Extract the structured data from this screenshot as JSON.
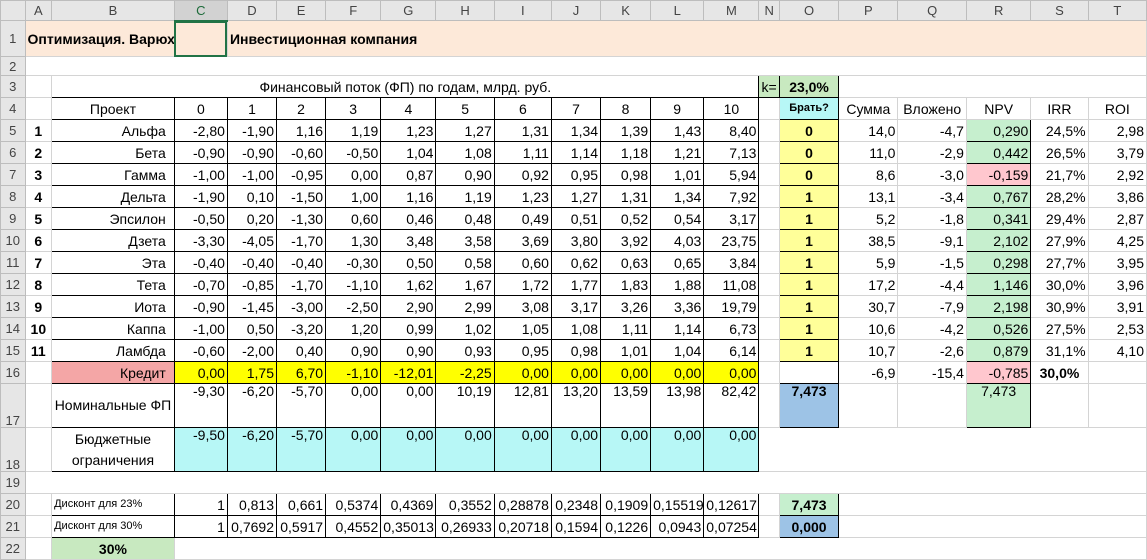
{
  "columns": [
    "A",
    "B",
    "C",
    "D",
    "E",
    "F",
    "G",
    "H",
    "I",
    "J",
    "K",
    "L",
    "M",
    "N",
    "O",
    "P",
    "Q",
    "R",
    "S",
    "T"
  ],
  "title_box": "Оптимизация. Варюхин С.Е. 2021 гг",
  "title": "Инвестиционная компания",
  "row3": {
    "label": "Финансовый поток (ФП) по годам, млрд. руб.",
    "k_label": "k=",
    "k_value": "23,0%"
  },
  "row4": {
    "project": "Проект",
    "years": [
      "0",
      "1",
      "2",
      "3",
      "4",
      "5",
      "6",
      "7",
      "8",
      "9",
      "10"
    ],
    "take": "Брать?",
    "sum": "Сумма",
    "invested": "Вложено",
    "npv": "NPV",
    "irr": "IRR",
    "roi": "ROI"
  },
  "projects": [
    {
      "idx": "1",
      "name": "Альфа",
      "flows": [
        "-2,80",
        "-1,90",
        "1,16",
        "1,19",
        "1,23",
        "1,27",
        "1,31",
        "1,34",
        "1,39",
        "1,43",
        "8,40"
      ],
      "take": "0",
      "sum": "14,0",
      "inv": "-4,7",
      "npv": "0,290",
      "irr": "24,5%",
      "roi": "2,98",
      "neg": false
    },
    {
      "idx": "2",
      "name": "Бета",
      "flows": [
        "-0,90",
        "-0,90",
        "-0,60",
        "-0,50",
        "1,04",
        "1,08",
        "1,11",
        "1,14",
        "1,18",
        "1,21",
        "7,13"
      ],
      "take": "0",
      "sum": "11,0",
      "inv": "-2,9",
      "npv": "0,442",
      "irr": "26,5%",
      "roi": "3,79",
      "neg": false
    },
    {
      "idx": "3",
      "name": "Гамма",
      "flows": [
        "-1,00",
        "-1,00",
        "-0,95",
        "0,00",
        "0,87",
        "0,90",
        "0,92",
        "0,95",
        "0,98",
        "1,01",
        "5,94"
      ],
      "take": "0",
      "sum": "8,6",
      "inv": "-3,0",
      "npv": "-0,159",
      "irr": "21,7%",
      "roi": "2,92",
      "neg": true
    },
    {
      "idx": "4",
      "name": "Дельта",
      "flows": [
        "-1,90",
        "0,10",
        "-1,50",
        "1,00",
        "1,16",
        "1,19",
        "1,23",
        "1,27",
        "1,31",
        "1,34",
        "7,92"
      ],
      "take": "1",
      "sum": "13,1",
      "inv": "-3,4",
      "npv": "0,767",
      "irr": "28,2%",
      "roi": "3,86",
      "neg": false
    },
    {
      "idx": "5",
      "name": "Эпсилон",
      "flows": [
        "-0,50",
        "0,20",
        "-1,30",
        "0,60",
        "0,46",
        "0,48",
        "0,49",
        "0,51",
        "0,52",
        "0,54",
        "3,17"
      ],
      "take": "1",
      "sum": "5,2",
      "inv": "-1,8",
      "npv": "0,341",
      "irr": "29,4%",
      "roi": "2,87",
      "neg": false
    },
    {
      "idx": "6",
      "name": "Дзета",
      "flows": [
        "-3,30",
        "-4,05",
        "-1,70",
        "1,30",
        "3,48",
        "3,58",
        "3,69",
        "3,80",
        "3,92",
        "4,03",
        "23,75"
      ],
      "take": "1",
      "sum": "38,5",
      "inv": "-9,1",
      "npv": "2,102",
      "irr": "27,9%",
      "roi": "4,25",
      "neg": false
    },
    {
      "idx": "7",
      "name": "Эта",
      "flows": [
        "-0,40",
        "-0,40",
        "-0,40",
        "-0,30",
        "0,50",
        "0,58",
        "0,60",
        "0,62",
        "0,63",
        "0,65",
        "3,84"
      ],
      "take": "1",
      "sum": "5,9",
      "inv": "-1,5",
      "npv": "0,298",
      "irr": "27,7%",
      "roi": "3,95",
      "neg": false
    },
    {
      "idx": "8",
      "name": "Тета",
      "flows": [
        "-0,70",
        "-0,85",
        "-1,70",
        "-1,10",
        "1,62",
        "1,67",
        "1,72",
        "1,77",
        "1,83",
        "1,88",
        "11,08"
      ],
      "take": "1",
      "sum": "17,2",
      "inv": "-4,4",
      "npv": "1,146",
      "irr": "30,0%",
      "roi": "3,96",
      "neg": false
    },
    {
      "idx": "9",
      "name": "Иота",
      "flows": [
        "-0,90",
        "-1,45",
        "-3,00",
        "-2,50",
        "2,90",
        "2,99",
        "3,08",
        "3,17",
        "3,26",
        "3,36",
        "19,79"
      ],
      "take": "1",
      "sum": "30,7",
      "inv": "-7,9",
      "npv": "2,198",
      "irr": "30,9%",
      "roi": "3,91",
      "neg": false
    },
    {
      "idx": "10",
      "name": "Каппа",
      "flows": [
        "-1,00",
        "0,50",
        "-3,20",
        "1,20",
        "0,99",
        "1,02",
        "1,05",
        "1,08",
        "1,11",
        "1,14",
        "6,73"
      ],
      "take": "1",
      "sum": "10,6",
      "inv": "-4,2",
      "npv": "0,526",
      "irr": "27,5%",
      "roi": "2,53",
      "neg": false
    },
    {
      "idx": "11",
      "name": "Ламбда",
      "flows": [
        "-0,60",
        "-2,00",
        "0,40",
        "0,90",
        "0,90",
        "0,93",
        "0,95",
        "0,98",
        "1,01",
        "1,04",
        "6,14"
      ],
      "take": "1",
      "sum": "10,7",
      "inv": "-2,6",
      "npv": "0,879",
      "irr": "31,1%",
      "roi": "4,10",
      "neg": false
    }
  ],
  "credit": {
    "name": "Кредит",
    "flows": [
      "0,00",
      "1,75",
      "6,70",
      "-1,10",
      "-12,01",
      "-2,25",
      "0,00",
      "0,00",
      "0,00",
      "0,00",
      "0,00"
    ],
    "sum": "-6,9",
    "inv": "-15,4",
    "npv": "-0,785",
    "irr": "30,0%"
  },
  "nominal": {
    "name": "Номинальные ФП",
    "flows": [
      "-9,30",
      "-6,20",
      "-5,70",
      "0,00",
      "0,00",
      "10,19",
      "12,81",
      "13,20",
      "13,59",
      "13,98",
      "82,42"
    ],
    "take": "7,473",
    "npv": "7,473"
  },
  "budget": {
    "name": "Бюджетные ограничения",
    "flows": [
      "-9,50",
      "-6,20",
      "-5,70",
      "0,00",
      "0,00",
      "0,00",
      "0,00",
      "0,00",
      "0,00",
      "0,00",
      "0,00"
    ]
  },
  "disc23": {
    "name": "Дисконт для 23%",
    "flows": [
      "1",
      "0,813",
      "0,661",
      "0,5374",
      "0,4369",
      "0,3552",
      "0,28878",
      "0,2348",
      "0,1909",
      "0,15519",
      "0,12617"
    ],
    "o": "7,473"
  },
  "disc30": {
    "name": "Дисконт для 30%",
    "flows": [
      "1",
      "0,7692",
      "0,5917",
      "0,4552",
      "0,35013",
      "0,26933",
      "0,20718",
      "0,1594",
      "0,1226",
      "0,0943",
      "0,07254"
    ],
    "o": "0,000"
  },
  "row22": {
    "b": "30%"
  }
}
